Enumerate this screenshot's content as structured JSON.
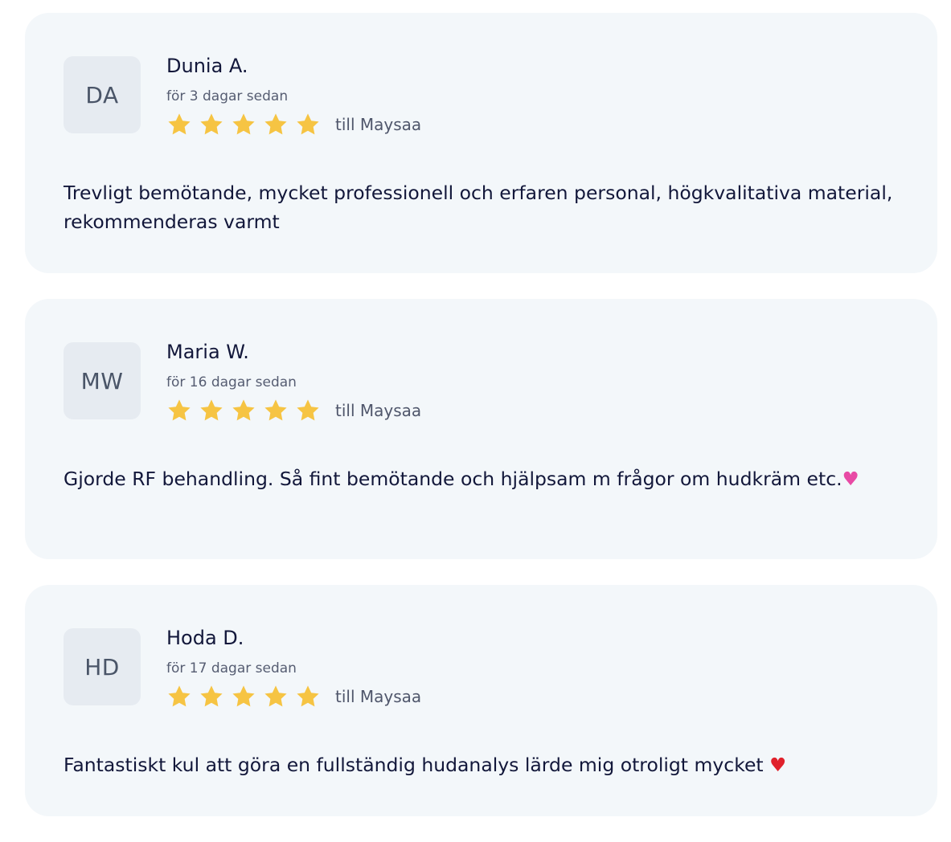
{
  "reviews": [
    {
      "initials": "DA",
      "name": "Dunia A.",
      "date": "för 3 dagar sedan",
      "rating": 5,
      "staff": "till Maysaa",
      "text": "Trevligt bemötande, mycket professionell och erfaren personal, högkvalitativa material, rekommenderas varmt",
      "emoji": ""
    },
    {
      "initials": "MW",
      "name": "Maria W.",
      "date": "för 16 dagar sedan",
      "rating": 5,
      "staff": "till Maysaa",
      "text": "Gjorde RF behandling. Så fint bemötande och hjälpsam m frågor om hudkräm etc.",
      "emoji": "♥"
    },
    {
      "initials": "HD",
      "name": "Hoda D.",
      "date": "för 17 dagar sedan",
      "rating": 5,
      "staff": "till Maysaa",
      "text": "Fantastiskt kul att göra en fullständig hudanalys lärde mig otroligt mycket ",
      "emoji": "♥"
    }
  ],
  "colors": {
    "card_background": "#f3f7fa",
    "avatar_background": "#e6ebf1",
    "star": "#f6c443",
    "heart_pink": "#e84aa5",
    "heart_red": "#e0212b"
  },
  "icons": {
    "rating_star": "star-icon",
    "pink_heart": "pink-heart-icon",
    "red_heart": "red-heart-icon"
  }
}
